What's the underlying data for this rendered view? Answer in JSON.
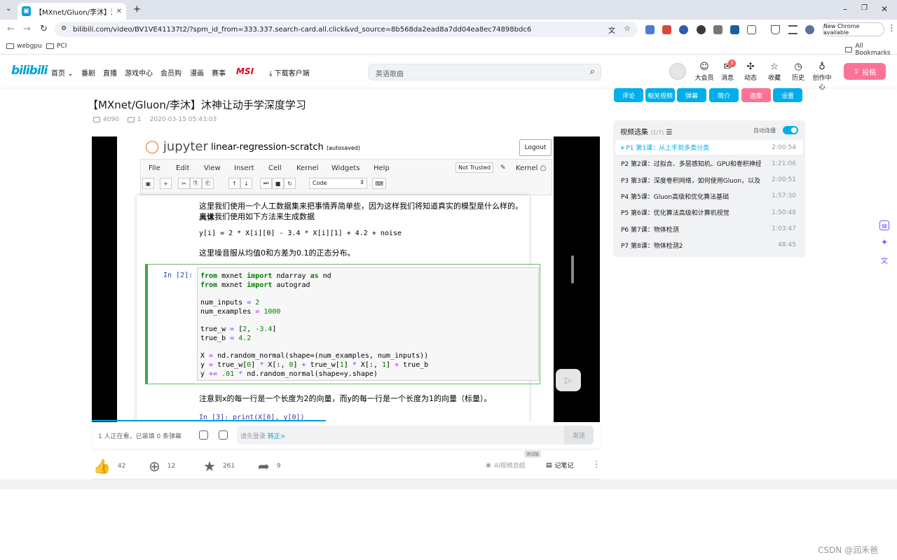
{
  "browser": {
    "tab_title": "【MXnet/Gluon/李沐】沐神让动手",
    "url": "bilibili.com/video/BV1VE41137t2/?spm_id_from=333.337.search-card.all.click&vd_source=8b568da2ead8a7dd04ea8ec74898bdc6",
    "new_chrome": "New Chrome available",
    "bookmarks": [
      "webgpu",
      "PCI"
    ],
    "all_bookmarks": "All Bookmarks"
  },
  "header": {
    "logo": "bilibili",
    "nav": [
      "首页",
      "番剧",
      "直播",
      "游戏中心",
      "会员购",
      "漫画",
      "赛事"
    ],
    "msi": "MSI",
    "download": "下载客户端",
    "search_placeholder": "英语歌曲",
    "icons": [
      "大会员",
      "消息",
      "动态",
      "收藏",
      "历史",
      "创作中心"
    ],
    "message_badge": "3",
    "upload": "投稿"
  },
  "video": {
    "title": "【MXnet/Gluon/李沐】沐神让动手学深度学习",
    "views": "4090",
    "danmaku": "1",
    "date": "2020-03-15 05:43:03"
  },
  "notebook": {
    "brand": "jupyter",
    "name": "linear-regression-scratch",
    "saved": "(autosaved)",
    "logout": "Logout",
    "menu": [
      "File",
      "Edit",
      "View",
      "Insert",
      "Cell",
      "Kernel",
      "Widgets",
      "Help"
    ],
    "trust": "Not Trusted",
    "kernel": "Kernel",
    "cell_type": "Code",
    "text1": "这里我们使用一个人工数据集来把事情弄简单些，因为这样我们将知道真实的模型是什么样的。具体",
    "text2": "来说我们使用如下方法来生成数据",
    "formula": "y[i] = 2 * X[i][0] - 3.4 * X[i][1] + 4.2 + noise",
    "text3": "这里噪音服从均值0和方差为0.1的正态分布。",
    "prompt": "In [2]:",
    "code_lines": [
      "from mxnet import ndarray as nd",
      "from mxnet import autograd",
      "",
      "num_inputs = 2",
      "num_examples = 1000",
      "",
      "true_w = [2, -3.4]",
      "true_b = 4.2",
      "",
      "X = nd.random_normal(shape=(num_examples, num_inputs))",
      "y = true_w[0] * X[:, 0] + true_w[1] * X[:, 1] + true_b",
      "y += .01 * nd.random_normal(shape=y.shape)"
    ],
    "text4": "注意到x的每一行是一个长度为2的向量，而y的每一行是一个长度为1的向量（标量）。",
    "cell3": "In [3]:  print(X[0], y[0])"
  },
  "danmaku_bar": {
    "watching": "1 人正在看，已装填 0 条弹幕",
    "placeholder": "请先登录",
    "login_link": "转正>",
    "send": "发送"
  },
  "actions": {
    "likes": "42",
    "coins": "12",
    "favs": "261",
    "shares": "9",
    "ai_summary": "AI视频总结",
    "ai_tag": "测试版",
    "notes": "记笔记"
  },
  "right_tabs": [
    "评论",
    "相关视频",
    "弹幕",
    "简介",
    "选集",
    "设置"
  ],
  "playlist": {
    "title": "视频选集",
    "count": "(1/7)",
    "autoplay": "自动连播",
    "items": [
      {
        "p": "P1",
        "title": "第1课：从上手到多类分类",
        "dur": "2:00:54"
      },
      {
        "p": "P2",
        "title": "第2课：过拟合、多层感知机、GPU和卷积神经...",
        "dur": "1:21:06"
      },
      {
        "p": "P3",
        "title": "第3课：深度卷积网络，如何使用Gluon，以及...",
        "dur": "2:00:51"
      },
      {
        "p": "P4",
        "title": "第5课：Gluon高级和优化算法基础",
        "dur": "1:57:30"
      },
      {
        "p": "P5",
        "title": "第6课：优化算法高级和计算机视觉",
        "dur": "1:50:48"
      },
      {
        "p": "P6",
        "title": "第7课：物体检测",
        "dur": "1:03:47"
      },
      {
        "p": "P7",
        "title": "第8课：物体检测2",
        "dur": "48:45"
      }
    ]
  },
  "watermark": "CSDN @润禾爸"
}
